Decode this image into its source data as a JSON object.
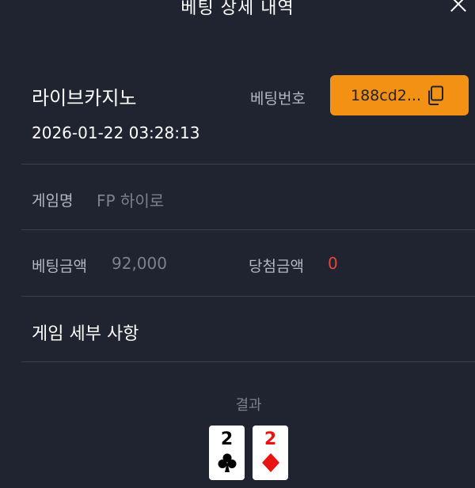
{
  "header": {
    "title": "베팅 상세 내역"
  },
  "bet": {
    "category": "라이브카지노",
    "datetime": "2026-01-22 03:28:13",
    "bet_number_label": "베팅번호",
    "bet_number": "188cd2..."
  },
  "game": {
    "name_label": "게임명",
    "name": "FP 하이로"
  },
  "amounts": {
    "bet_label": "베팅금액",
    "bet_value": "92,000",
    "win_label": "당첨금액",
    "win_value": "0"
  },
  "details": {
    "title": "게임 세부 사항",
    "result_label": "결과",
    "cards": [
      {
        "rank": "2",
        "suit": "club-icon",
        "color": "#000000"
      },
      {
        "rank": "2",
        "suit": "diamond-icon",
        "color": "#e8140f"
      }
    ]
  },
  "colors": {
    "background": "#1f2430",
    "accent": "#f29114",
    "muted": "#7c818b",
    "loss": "#e8453c"
  }
}
